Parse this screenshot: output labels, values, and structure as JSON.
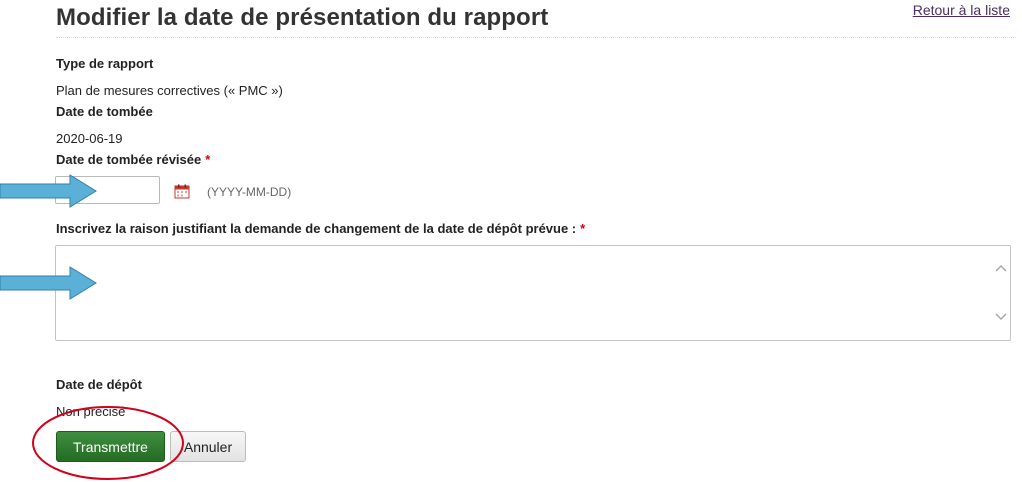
{
  "page": {
    "title": "Modifier la date de présentation du rapport",
    "back_link": "Retour à la liste"
  },
  "fields": {
    "report_type": {
      "label": "Type de rapport",
      "value": "Plan de mesures correctives (« PMC »)"
    },
    "due_date": {
      "label": "Date de tombée",
      "value": "2020-06-19"
    },
    "revised_due_date": {
      "label": "Date de tombée révisée",
      "required_marker": "*",
      "value": "",
      "hint": "(YYYY-MM-DD)"
    },
    "reason": {
      "label": "Inscrivez la raison justifiant la demande de changement de la date de dépôt prévue :",
      "required_marker": "*",
      "value": ""
    },
    "submission_date": {
      "label": "Date de dépôt",
      "value": "Non précisé"
    }
  },
  "buttons": {
    "submit_label": "Transmettre",
    "cancel_label": "Annuler"
  },
  "colors": {
    "submit_button": "#2f7d2f",
    "link": "#4a2e63",
    "required": "#d0021b",
    "annotation_arrow": "#4aa3d0",
    "annotation_circle": "#d0021b"
  },
  "icons": {
    "calendar": "calendar-icon",
    "scroll_up": "chevron-up-icon",
    "scroll_down": "chevron-down-icon"
  }
}
